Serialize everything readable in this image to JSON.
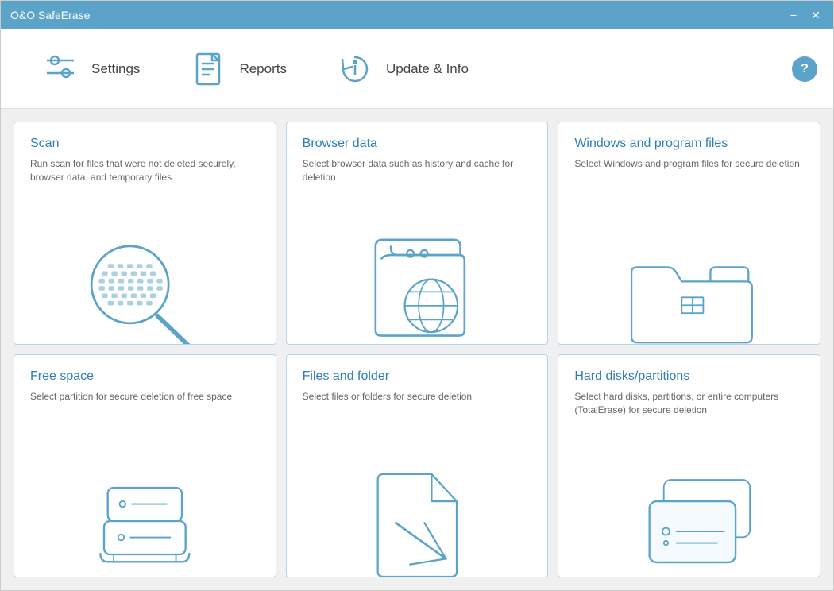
{
  "window": {
    "title": "O&O SafeErase"
  },
  "toolbar": {
    "settings_label": "Settings",
    "reports_label": "Reports",
    "update_label": "Update & Info",
    "help_label": "?"
  },
  "cards": [
    {
      "id": "scan",
      "title": "Scan",
      "desc": "Run scan for files that were not deleted securely, browser data, and temporary files"
    },
    {
      "id": "browser-data",
      "title": "Browser data",
      "desc": "Select browser data such as history and cache for deletion"
    },
    {
      "id": "windows-program-files",
      "title": "Windows and program files",
      "desc": "Select Windows and program files for secure deletion"
    },
    {
      "id": "free-space",
      "title": "Free space",
      "desc": "Select partition for secure deletion of free space"
    },
    {
      "id": "files-folder",
      "title": "Files and folder",
      "desc": "Select files or folders for secure deletion"
    },
    {
      "id": "hard-disks",
      "title": "Hard disks/partitions",
      "desc": "Select hard disks, partitions, or entire computers (TotalErase) for secure deletion"
    }
  ],
  "titlebar_controls": {
    "minimize": "−",
    "close": "✕"
  }
}
